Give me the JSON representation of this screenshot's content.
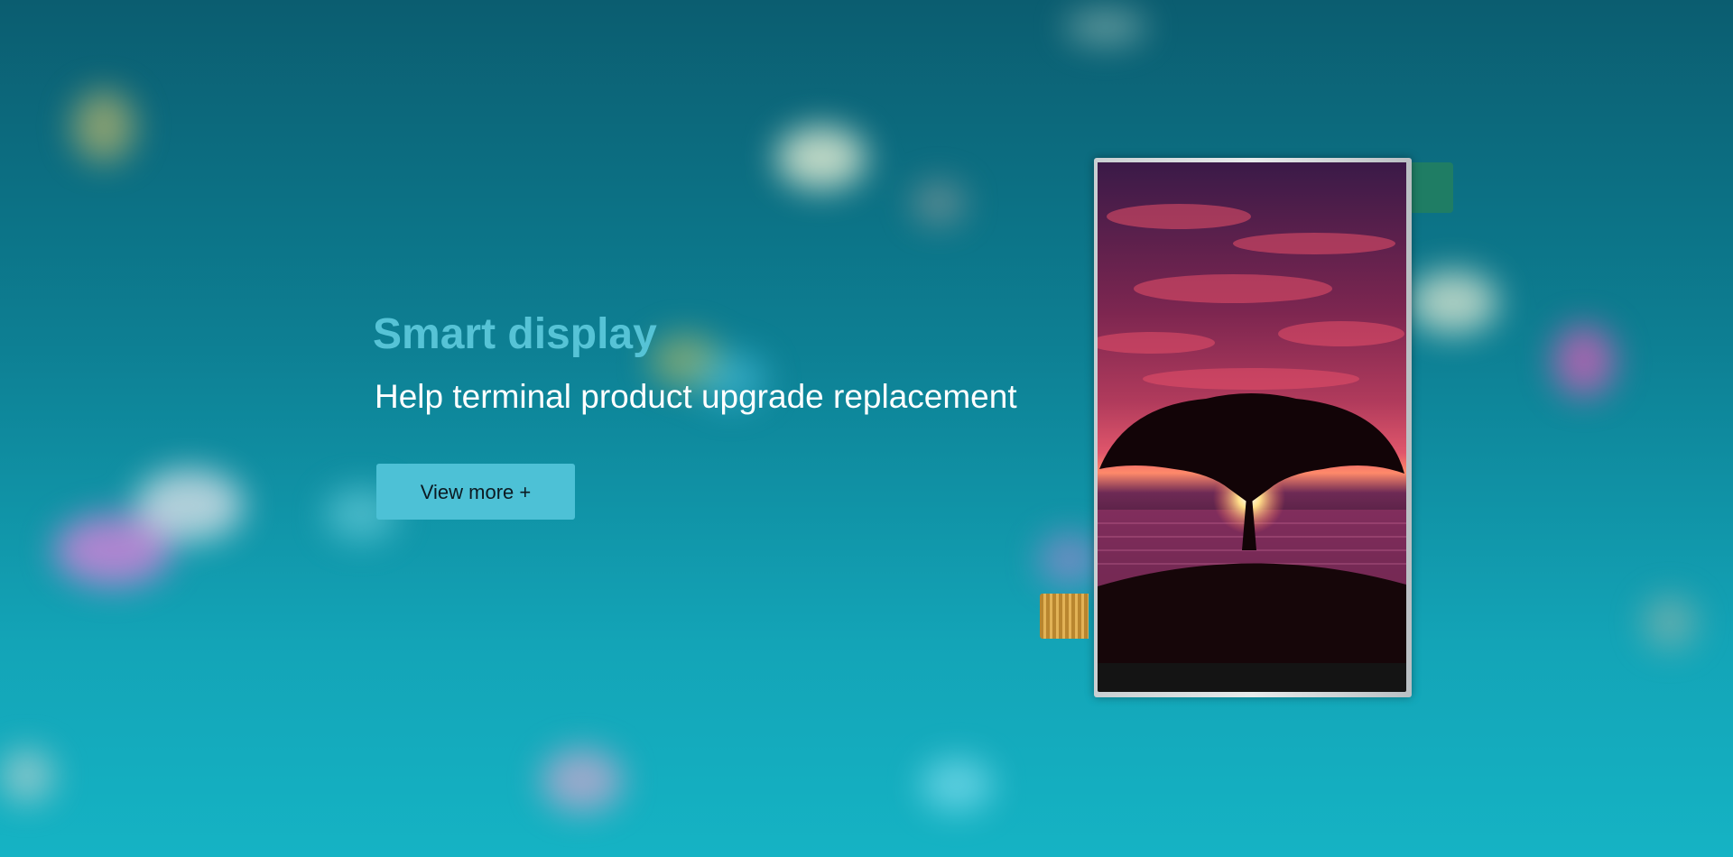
{
  "hero": {
    "title": "Smart display",
    "subtitle": "Help terminal product upgrade replacement",
    "button_label": "View more +"
  },
  "colors": {
    "title": "#56c3d6",
    "subtitle": "#ffffff",
    "button_bg": "#4dc1d6",
    "background": "#0d7f93"
  },
  "product_image": {
    "icon": "lcd-display-module-icon"
  }
}
